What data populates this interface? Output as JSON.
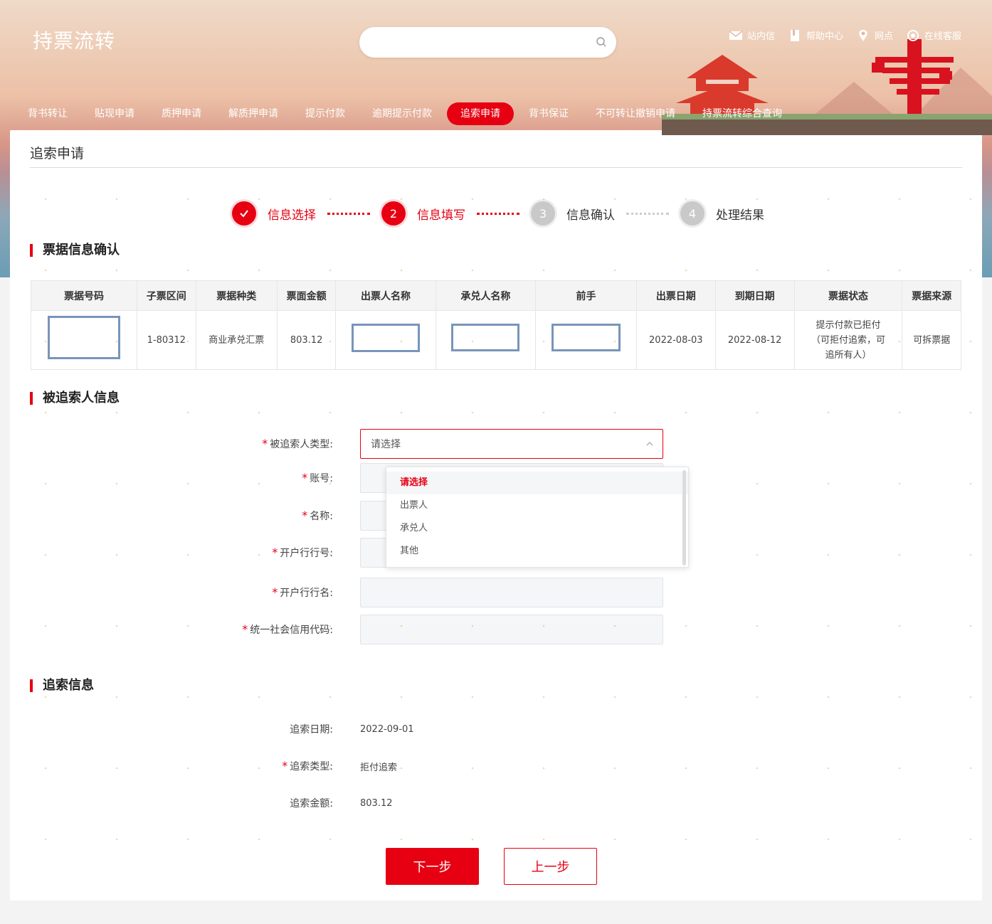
{
  "app": {
    "title": "持票流转"
  },
  "search": {
    "placeholder": ""
  },
  "toplinks": [
    "站内信",
    "帮助中心",
    "网点",
    "在线客服"
  ],
  "nav": [
    "背书转让",
    "贴现申请",
    "质押申请",
    "解质押申请",
    "提示付款",
    "逾期提示付款",
    "追索申请",
    "背书保证",
    "不可转让撤销申请",
    "持票流转综合查询"
  ],
  "nav_active": "追索申请",
  "page": {
    "title": "追索申请"
  },
  "steps": [
    {
      "num": "✓",
      "label": "信息选择",
      "state": "done"
    },
    {
      "num": "2",
      "label": "信息填写",
      "state": "current"
    },
    {
      "num": "3",
      "label": "信息确认",
      "state": "todo"
    },
    {
      "num": "4",
      "label": "处理结果",
      "state": "todo"
    }
  ],
  "bill_section": {
    "title": "票据信息确认",
    "headers": [
      "票据号码",
      "子票区间",
      "票据种类",
      "票面金额",
      "出票人名称",
      "承兑人名称",
      "前手",
      "出票日期",
      "到期日期",
      "票据状态",
      "票据来源"
    ],
    "row": {
      "sub_range": "1-80312",
      "type": "商业承兑汇票",
      "amount": "803.12",
      "issue_date": "2022-08-03",
      "due_date": "2022-08-12",
      "status": "提示付款已拒付（可拒付追索，可追所有人）",
      "source": "可拆票据"
    }
  },
  "recourse_party": {
    "title": "被追索人信息",
    "fields": {
      "type_label": "被追索人类型:",
      "account_label": "账号:",
      "name_label": "名称:",
      "bank_no_label": "开户行行号:",
      "bank_name_label": "开户行行名:",
      "credit_code_label": "统一社会信用代码:"
    },
    "select_value": "请选择",
    "options": [
      "请选择",
      "出票人",
      "承兑人",
      "其他"
    ]
  },
  "recourse_info": {
    "title": "追索信息",
    "date_label": "追索日期:",
    "date_value": "2022-09-01",
    "type_label": "追索类型:",
    "type_value": "拒付追索",
    "amount_label": "追索金额:",
    "amount_value": "803.12"
  },
  "buttons": {
    "next": "下一步",
    "prev": "上一步"
  },
  "colors": {
    "accent": "#e60012",
    "mask_border": "#7895ba"
  }
}
